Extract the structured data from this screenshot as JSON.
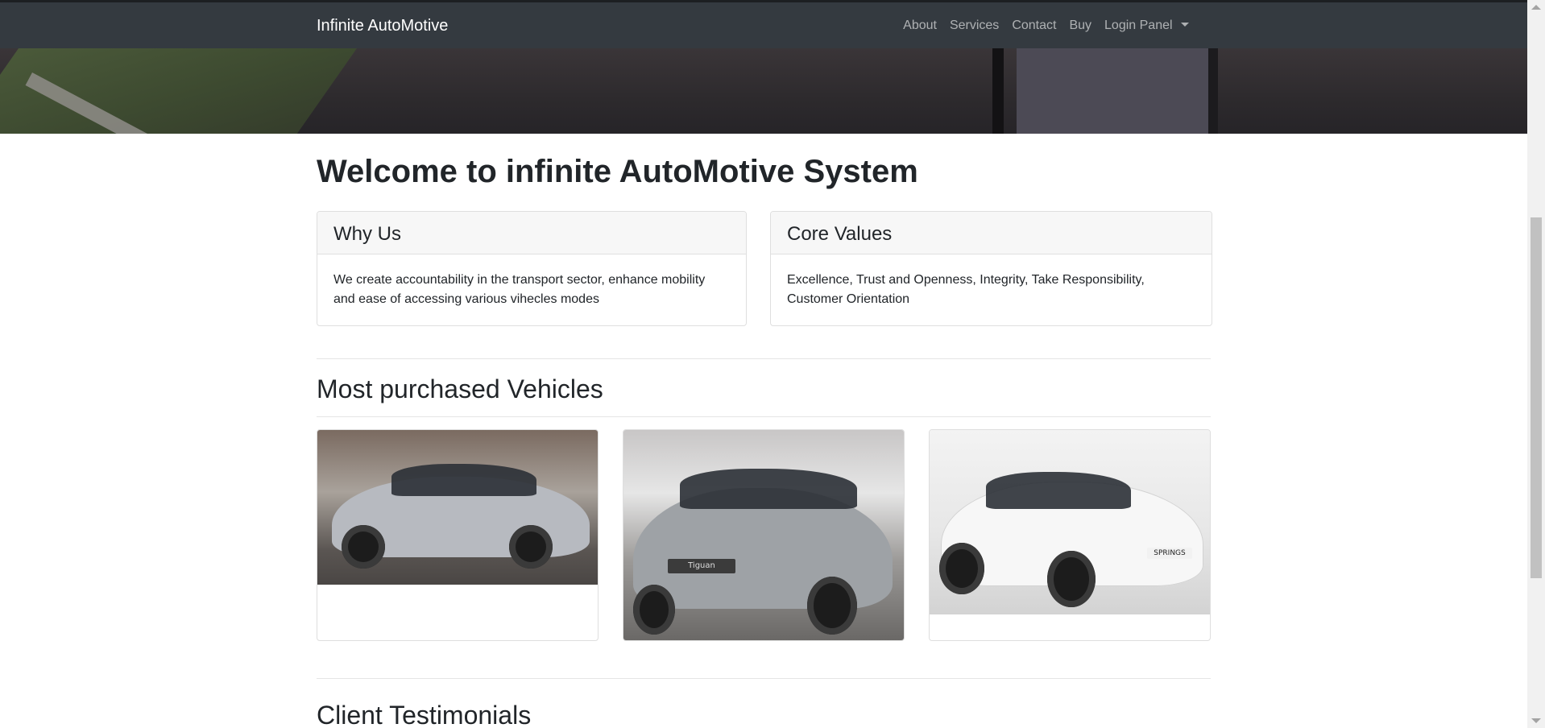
{
  "navbar": {
    "brand": "Infinite AutoMotive",
    "links": [
      "About",
      "Services",
      "Contact",
      "Buy"
    ],
    "login_label": "Login Panel"
  },
  "main": {
    "welcome_title": "Welcome to infinite AutoMotive System",
    "cards": [
      {
        "title": "Why Us",
        "body": "We create accountability in the transport sector, enhance mobility and ease of accessing various vihecles modes"
      },
      {
        "title": "Core Values",
        "body": "Excellence, Trust and Openness, Integrity, Take Responsibility, Customer Orientation"
      }
    ],
    "vehicles_title": "Most purchased Vehicles",
    "vehicle_plate_text": "Tiguan",
    "vehicle_plate_text_2": "SPRINGS",
    "testimonials_title": "Client Testimonials"
  },
  "colors": {
    "navbar": "#343a40",
    "nav_link": "rgba(255,255,255,0.6)",
    "text": "#212529"
  },
  "icons": {
    "dropdown": "caret-down-icon"
  }
}
